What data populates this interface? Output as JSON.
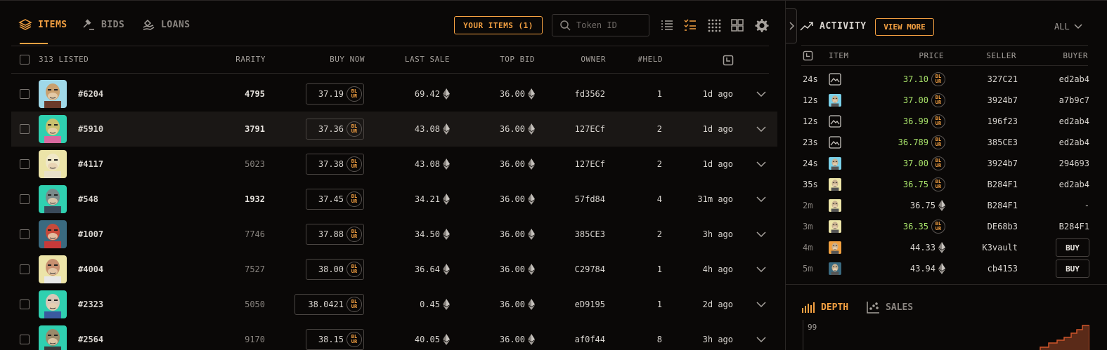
{
  "nav": {
    "items_label": "ITEMS",
    "bids_label": "BIDS",
    "loans_label": "LOANS",
    "your_items_label": "YOUR ITEMS (1)",
    "search_placeholder": "Token ID"
  },
  "table": {
    "listed_label": "313 LISTED",
    "headers": {
      "rarity": "RARITY",
      "buy_now": "BUY NOW",
      "last_sale": "LAST SALE",
      "top_bid": "TOP BID",
      "owner": "OWNER",
      "held": "#HELD"
    },
    "rows": [
      {
        "id": "#6204",
        "rarity": "4795",
        "rarity_bold": true,
        "buy_now": "37.19",
        "last_sale": "69.42",
        "top_bid": "36.00",
        "owner": "fd3562",
        "held": "1",
        "time": "1d ago",
        "bg": "#9fd8e8",
        "fur": "#c9a06e",
        "shirt": "#6b3a2a"
      },
      {
        "id": "#5910",
        "rarity": "3791",
        "rarity_bold": true,
        "buy_now": "37.36",
        "last_sale": "43.08",
        "top_bid": "36.00",
        "owner": "127ECf",
        "held": "2",
        "time": "1d ago",
        "bg": "#2fd0b0",
        "fur": "#c9c06e",
        "shirt": "#d86aa0"
      },
      {
        "id": "#4117",
        "rarity": "5023",
        "rarity_bold": false,
        "buy_now": "37.38",
        "last_sale": "43.08",
        "top_bid": "36.00",
        "owner": "127ECf",
        "held": "2",
        "time": "1d ago",
        "bg": "#ece4a8",
        "fur": "#f0e8c8",
        "shirt": "#e8e0c8"
      },
      {
        "id": "#548",
        "rarity": "1932",
        "rarity_bold": true,
        "buy_now": "37.45",
        "last_sale": "34.21",
        "top_bid": "36.00",
        "owner": "57fd84",
        "held": "4",
        "time": "31m ago",
        "bg": "#2fd0b0",
        "fur": "#7a8a8a",
        "shirt": "#3a4a5a"
      },
      {
        "id": "#1007",
        "rarity": "7746",
        "rarity_bold": false,
        "buy_now": "37.88",
        "last_sale": "34.50",
        "top_bid": "36.00",
        "owner": "385CE3",
        "held": "2",
        "time": "3h ago",
        "bg": "#3a6a80",
        "fur": "#c84a3a",
        "shirt": "#c83a3a"
      },
      {
        "id": "#4004",
        "rarity": "7527",
        "rarity_bold": false,
        "buy_now": "38.00",
        "last_sale": "36.64",
        "top_bid": "36.00",
        "owner": "C29784",
        "held": "1",
        "time": "4h ago",
        "bg": "#ece4a8",
        "fur": "#c89070",
        "shirt": "#e8e8e8"
      },
      {
        "id": "#2323",
        "rarity": "5050",
        "rarity_bold": false,
        "buy_now": "38.0421",
        "last_sale": "0.45",
        "top_bid": "36.00",
        "owner": "eD9195",
        "held": "1",
        "time": "2d ago",
        "bg": "#2fd0b0",
        "fur": "#d8c8b8",
        "shirt": "#3a5aa0"
      },
      {
        "id": "#2564",
        "rarity": "9170",
        "rarity_bold": false,
        "buy_now": "38.15",
        "last_sale": "40.05",
        "top_bid": "36.00",
        "owner": "af0f44",
        "held": "8",
        "time": "3h ago",
        "bg": "#2fd0b0",
        "fur": "#9a8a6a",
        "shirt": "#3a3a3a"
      }
    ],
    "coin_text": "BL\nUR"
  },
  "activity": {
    "title": "ACTIVITY",
    "view_more": "VIEW MORE",
    "filter": "ALL",
    "headers": {
      "item": "ITEM",
      "price": "PRICE",
      "seller": "SELLER",
      "buyer": "BUYER"
    },
    "rows": [
      {
        "time": "24s",
        "kind": "collection",
        "price": "37.10",
        "currency": "blur",
        "green": true,
        "seller": "327C21",
        "buyer": "ed2ab4"
      },
      {
        "time": "12s",
        "kind": "nft",
        "thumb": "#7ad0e8",
        "price": "37.00",
        "currency": "blur",
        "green": true,
        "seller": "3924b7",
        "buyer": "a7b9c7"
      },
      {
        "time": "12s",
        "kind": "collection",
        "price": "36.99",
        "currency": "blur",
        "green": true,
        "seller": "196f23",
        "buyer": "ed2ab4"
      },
      {
        "time": "23s",
        "kind": "collection",
        "price": "36.789",
        "currency": "blur",
        "green": true,
        "seller": "385CE3",
        "buyer": "ed2ab4"
      },
      {
        "time": "24s",
        "kind": "nft",
        "thumb": "#7ad0e8",
        "price": "37.00",
        "currency": "blur",
        "green": true,
        "seller": "3924b7",
        "buyer": "294693"
      },
      {
        "time": "35s",
        "kind": "nft",
        "thumb": "#ece4a8",
        "price": "36.75",
        "currency": "blur",
        "green": true,
        "seller": "B284F1",
        "buyer": "ed2ab4"
      },
      {
        "time": "2m",
        "kind": "nft",
        "thumb": "#ece4a8",
        "price": "36.75",
        "currency": "eth",
        "green": false,
        "seller": "B284F1",
        "buyer": "-"
      },
      {
        "time": "3m",
        "kind": "nft",
        "thumb": "#ece4a8",
        "price": "36.35",
        "currency": "blur",
        "green": true,
        "seller": "DE68b3",
        "buyer": "B284F1"
      },
      {
        "time": "4m",
        "kind": "nft",
        "thumb": "#f0a040",
        "price": "44.33",
        "currency": "eth",
        "green": false,
        "seller": "K3vault",
        "buyer": "BUY",
        "buyer_is_button": true
      },
      {
        "time": "5m",
        "kind": "nft",
        "thumb": "#3a6a80",
        "price": "43.94",
        "currency": "eth",
        "green": false,
        "seller": "cb4153",
        "buyer": "BUY",
        "buyer_is_button": true
      }
    ]
  },
  "depth": {
    "depth_label": "DEPTH",
    "sales_label": "SALES",
    "y_tick": "99"
  },
  "colors": {
    "accent": "#f5a142",
    "positive": "#a8e26a",
    "background": "#0a0807"
  }
}
